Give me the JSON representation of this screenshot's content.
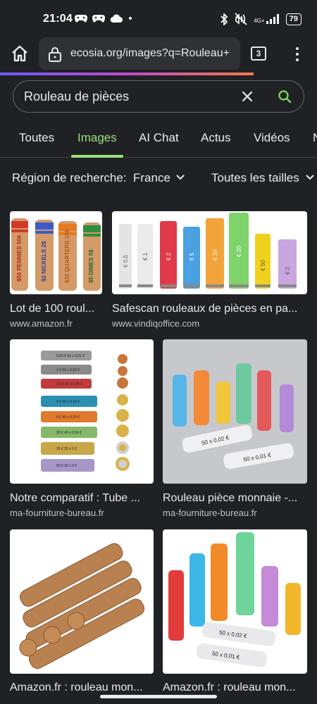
{
  "status_bar": {
    "time": "21:04",
    "network": "4G+",
    "battery": "79"
  },
  "browser": {
    "url": "ecosia.org/images?q=Rouleau+",
    "tab_count": "3"
  },
  "search": {
    "query": "Rouleau de pièces"
  },
  "tabs": [
    {
      "label": "Toutes"
    },
    {
      "label": "Images"
    },
    {
      "label": "AI Chat"
    },
    {
      "label": "Actus"
    },
    {
      "label": "Vidéos"
    },
    {
      "label": "N"
    }
  ],
  "filters": {
    "region_label": "Région de recherche:",
    "region_value": "France",
    "size_label": "Toutes les tailles"
  },
  "results": [
    {
      "title": "Lot de 100 roul...",
      "source": "www.amazon.fr"
    },
    {
      "title": "Safescan rouleaux de pièces en pa...",
      "source": "www.vindiqoffice.com"
    },
    {
      "title": "Notre comparatif : Tube ...",
      "source": "ma-fourniture-bureau.fr"
    },
    {
      "title": "Rouleau pièce monnaie -...",
      "source": "ma-fourniture-bureau.fr"
    },
    {
      "title": "Amazon.fr : rouleau mon...",
      "source": ""
    },
    {
      "title": "Amazon.fr : rouleau mon...",
      "source": ""
    }
  ],
  "thumb_text": {
    "r1": [
      "$50 PENNIES 50¢",
      "$2 NICKELS 2$",
      "$10 QUARTERS 10$",
      "$5 DIMES 5$"
    ],
    "r2": [
      "€ 0,5",
      "€ 1",
      "€ 2",
      "€ 5",
      "€ 10",
      "€ 20",
      "€ 50",
      "€ 2"
    ],
    "r3": [
      "0,50 €  50 x 0,01 €",
      "1 €  50 x 0,02 €",
      "2,5 €  50 x 0,05 €",
      "4 €  40 x 0,10 €",
      "8 €  40 x 0,20 €",
      "20 €  40 x 0,50 €",
      "25 €  25 x 1 €",
      "50 €  25 x 2 €"
    ],
    "r4": [
      "50 x 0,02 €",
      "50 x 0,01 €"
    ],
    "r6": [
      "50 x 0,02 €",
      "50 x 0,01 €"
    ]
  },
  "colors": {
    "accent": "#9be07a",
    "background": "#202124"
  }
}
